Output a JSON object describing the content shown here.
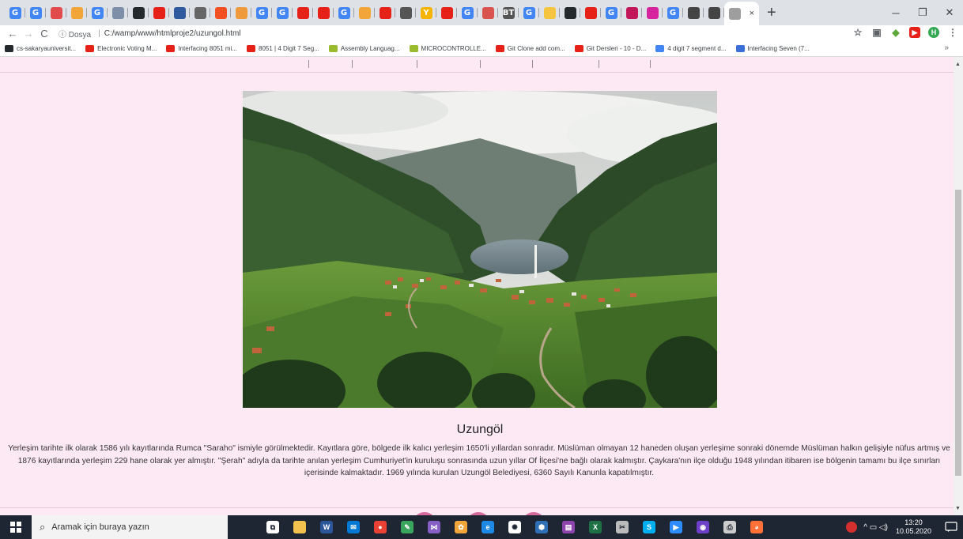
{
  "browser": {
    "tabs": [
      {
        "icon": "google-icon",
        "letter": "G",
        "color": "#4285f4"
      },
      {
        "icon": "google-icon",
        "letter": "G",
        "color": "#4285f4"
      },
      {
        "icon": "rocket-icon",
        "letter": "",
        "color": "#e24b4b"
      },
      {
        "icon": "star-icon",
        "letter": "",
        "color": "#f2a63a"
      },
      {
        "icon": "google-icon",
        "letter": "G",
        "color": "#4285f4"
      },
      {
        "icon": "mail-icon",
        "letter": "",
        "color": "#7d8ea8"
      },
      {
        "icon": "github-icon",
        "letter": "",
        "color": "#24292e"
      },
      {
        "icon": "youtube-icon",
        "letter": "",
        "color": "#e62117"
      },
      {
        "icon": "globe-icon",
        "letter": "",
        "color": "#2f5a9e"
      },
      {
        "icon": "openai-icon",
        "letter": "",
        "color": "#666666"
      },
      {
        "icon": "microsoft-icon",
        "letter": "",
        "color": "#f25022"
      },
      {
        "icon": "compass-icon",
        "letter": "",
        "color": "#f09a3e"
      },
      {
        "icon": "google-icon",
        "letter": "G",
        "color": "#4285f4"
      },
      {
        "icon": "google-icon",
        "letter": "G",
        "color": "#4285f4"
      },
      {
        "icon": "youtube-icon",
        "letter": "",
        "color": "#e62117"
      },
      {
        "icon": "youtube-icon",
        "letter": "",
        "color": "#e62117"
      },
      {
        "icon": "google-icon",
        "letter": "G",
        "color": "#4285f4"
      },
      {
        "icon": "person-icon",
        "letter": "",
        "color": "#f2a63a"
      },
      {
        "icon": "youtube-icon",
        "letter": "",
        "color": "#e62117"
      },
      {
        "icon": "timer-icon",
        "letter": "",
        "color": "#555555"
      },
      {
        "icon": "y-icon",
        "letter": "Y",
        "color": "#f5b400"
      },
      {
        "icon": "youtube-icon",
        "letter": "",
        "color": "#e62117"
      },
      {
        "icon": "google-icon",
        "letter": "G",
        "color": "#4285f4"
      },
      {
        "icon": "calculator-icon",
        "letter": "",
        "color": "#d9534f"
      },
      {
        "icon": "bt-icon",
        "letter": "BT",
        "color": "#555555"
      },
      {
        "icon": "google-icon",
        "letter": "G",
        "color": "#4285f4"
      },
      {
        "icon": "circle-icon",
        "letter": "",
        "color": "#f5c542"
      },
      {
        "icon": "github-icon",
        "letter": "",
        "color": "#24292e"
      },
      {
        "icon": "youtube-icon",
        "letter": "",
        "color": "#e62117"
      },
      {
        "icon": "google-icon",
        "letter": "G",
        "color": "#4285f4"
      },
      {
        "icon": "pen-icon",
        "letter": "",
        "color": "#c2185b"
      },
      {
        "icon": "instagram-icon",
        "letter": "",
        "color": "#d6249f"
      },
      {
        "icon": "google-icon",
        "letter": "G",
        "color": "#4285f4"
      },
      {
        "icon": "document-icon",
        "letter": "",
        "color": "#444444"
      },
      {
        "icon": "document-icon",
        "letter": "",
        "color": "#444444"
      }
    ],
    "active_tab_close": "×",
    "new_tab": "+",
    "window_controls": {
      "minimize": "─",
      "restore": "❐",
      "close": "✕"
    },
    "address": {
      "info_label": "ⓘ Dosya",
      "url": "C:/wamp/www/htmlproje2/uzungol.html"
    },
    "extensions": [
      {
        "icon": "bookmark-star-icon",
        "letter": "☆",
        "color": "#5f6368"
      },
      {
        "icon": "extension-icon",
        "letter": "▣",
        "color": "#5f6368"
      },
      {
        "icon": "shield-icon",
        "letter": "◆",
        "color": "#5fa83a"
      },
      {
        "icon": "youtube-icon",
        "letter": "▶",
        "color": "#e62117"
      },
      {
        "icon": "profile-avatar-icon",
        "letter": "H",
        "color": "#34a853"
      },
      {
        "icon": "menu-icon",
        "letter": "⋮",
        "color": "#5f6368"
      }
    ],
    "bookmarks": [
      {
        "icon": "github-icon",
        "label": "cs-sakaryauniversit...",
        "color": "#24292e"
      },
      {
        "icon": "youtube-icon",
        "label": "Electronic Voting M...",
        "color": "#e62117"
      },
      {
        "icon": "youtube-icon",
        "label": "Interfacing 8051 mi...",
        "color": "#e62117"
      },
      {
        "icon": "youtube-icon",
        "label": "8051 | 4 Digit 7 Seg...",
        "color": "#e62117"
      },
      {
        "icon": "uc-icon",
        "label": "Assembly Languag...",
        "color": "#9bbb2f"
      },
      {
        "icon": "uc-icon",
        "label": "MICROCONTROLLE...",
        "color": "#9bbb2f"
      },
      {
        "icon": "youtube-icon",
        "label": "Git Clone add com...",
        "color": "#e62117"
      },
      {
        "icon": "youtube-icon",
        "label": "Git Dersleri - 10 - D...",
        "color": "#e62117"
      },
      {
        "icon": "google-icon",
        "label": "4 digit 7 segment d...",
        "color": "#4285f4"
      },
      {
        "icon": "diamond-icon",
        "label": "Interfacing Seven (7...",
        "color": "#3b6fd8"
      }
    ],
    "bookmarks_more": "»"
  },
  "page": {
    "title": "Uzungöl",
    "paragraph": "Yerleşim tarihte ilk olarak 1586 yılı kayıtlarında Rumca \"Saraho\" ismiyle görülmektedir. Kayıtlara göre, bölgede ilk kalıcı yerleşim 1650'li yıllardan sonradır. Müslüman olmayan 12 haneden oluşan yerleşime sonraki dönemde Müslüman halkın gelişiyle nüfus artmış ve 1876 kayıtlarında yerleşim 229 hane olarak yer almıştır. \"Şerah\" adıyla da tarihte anılan yerleşim Cumhuriyet'in kuruluşu sonrasında uzun yıllar Of İlçesi'ne bağlı olarak kalmıştır. Çaykara'nın ilçe olduğu 1948 yılından itibaren ise bölgenin tamamı bu ilçe sınırları içerisinde kalmaktadır. 1969 yılında kurulan Uzungöl Belediyesi, 6360 Sayılı Kanunla kapatılmıştır."
  },
  "taskbar": {
    "search_placeholder": "Aramak için buraya yazın",
    "apps": [
      {
        "icon": "task-view-icon",
        "color": "#ffffff",
        "letter": "⧉"
      },
      {
        "icon": "file-explorer-icon",
        "color": "#f2c14e",
        "letter": ""
      },
      {
        "icon": "word-icon",
        "color": "#2b579a",
        "letter": "W"
      },
      {
        "icon": "mail-icon",
        "color": "#0078d4",
        "letter": "✉"
      },
      {
        "icon": "chrome-icon",
        "color": "#e94235",
        "letter": "●"
      },
      {
        "icon": "notepad-icon",
        "color": "#3aa55d",
        "letter": "✎"
      },
      {
        "icon": "visual-studio-icon",
        "color": "#865fc5",
        "letter": "⋈"
      },
      {
        "icon": "paint-icon",
        "color": "#f2a63a",
        "letter": "✿"
      },
      {
        "icon": "edge-icon",
        "color": "#1e88e5",
        "letter": "e"
      },
      {
        "icon": "settings-wheel-icon",
        "color": "#ffffff",
        "letter": "✺"
      },
      {
        "icon": "virtualbox-icon",
        "color": "#2f6fb3",
        "letter": "⬢"
      },
      {
        "icon": "terminal-icon",
        "color": "#8e44ad",
        "letter": "▤"
      },
      {
        "icon": "excel-icon",
        "color": "#1e7145",
        "letter": "X"
      },
      {
        "icon": "snipping-icon",
        "color": "#bbbbbb",
        "letter": "✂"
      },
      {
        "icon": "skype-icon",
        "color": "#00aff0",
        "letter": "S"
      },
      {
        "icon": "zoom-icon",
        "color": "#2d8cff",
        "letter": "▶"
      },
      {
        "icon": "github-desktop-icon",
        "color": "#6e40c9",
        "letter": "◉"
      },
      {
        "icon": "scanner-icon",
        "color": "#cccccc",
        "letter": "⎙"
      },
      {
        "icon": "firefox-icon",
        "color": "#ff7139",
        "letter": "◕"
      }
    ],
    "tray": {
      "time": "13:20",
      "date": "10.05.2020",
      "symbols": "^ ▭ ◁)"
    }
  }
}
